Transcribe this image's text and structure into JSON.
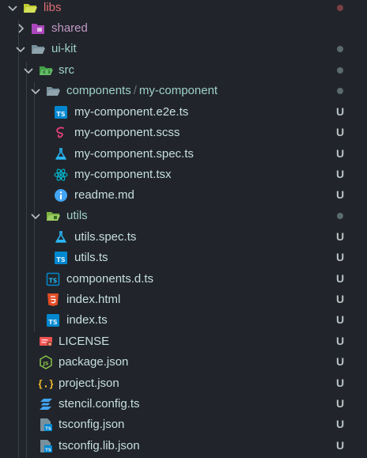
{
  "colors": {
    "background": "#21252b",
    "folder_label": "#9fd0cb",
    "root_label": "#e06c75",
    "untracked_badge": "#b9c3c3",
    "dot_modified": "#5b6a6d",
    "dot_error": "#7a3f43"
  },
  "tree": {
    "libs": {
      "label": "libs",
      "icon": "folder-open-icon"
    },
    "shared": {
      "label": "shared",
      "icon": "folder-closed-icon"
    },
    "ui_kit": {
      "label": "ui-kit",
      "icon": "folder-open-icon"
    },
    "src": {
      "label": "src",
      "icon": "folder-src-icon"
    },
    "components": {
      "label": "components",
      "separator": "/",
      "sublabel": "my-component",
      "icon": "folder-open-icon"
    },
    "e2e": {
      "label": "my-component.e2e.ts",
      "badge": "U",
      "icon": "typescript-icon"
    },
    "scss": {
      "label": "my-component.scss",
      "badge": "U",
      "icon": "sass-icon"
    },
    "spec": {
      "label": "my-component.spec.ts",
      "badge": "U",
      "icon": "flask-test-icon"
    },
    "tsx": {
      "label": "my-component.tsx",
      "badge": "U",
      "icon": "react-icon"
    },
    "readme": {
      "label": "readme.md",
      "badge": "U",
      "icon": "info-icon"
    },
    "utils": {
      "label": "utils",
      "icon": "folder-utils-icon"
    },
    "utils_spec": {
      "label": "utils.spec.ts",
      "badge": "U",
      "icon": "flask-test-icon"
    },
    "utils_ts": {
      "label": "utils.ts",
      "badge": "U",
      "icon": "typescript-icon"
    },
    "components_d": {
      "label": "components.d.ts",
      "badge": "U",
      "icon": "typescript-def-icon"
    },
    "index_html": {
      "label": "index.html",
      "badge": "U",
      "icon": "html5-icon"
    },
    "index_ts": {
      "label": "index.ts",
      "badge": "U",
      "icon": "typescript-icon"
    },
    "license": {
      "label": "LICENSE",
      "badge": "U",
      "icon": "license-icon"
    },
    "package_json": {
      "label": "package.json",
      "badge": "U",
      "icon": "nodejs-icon"
    },
    "project_json": {
      "label": "project.json",
      "badge": "U",
      "icon": "json-braces-icon"
    },
    "stencil": {
      "label": "stencil.config.ts",
      "badge": "U",
      "icon": "stencil-icon"
    },
    "tsconfig": {
      "label": "tsconfig.json",
      "badge": "U",
      "icon": "tsconfig-icon"
    },
    "tsconfig_lib": {
      "label": "tsconfig.lib.json",
      "badge": "U",
      "icon": "tsconfig-icon"
    }
  }
}
